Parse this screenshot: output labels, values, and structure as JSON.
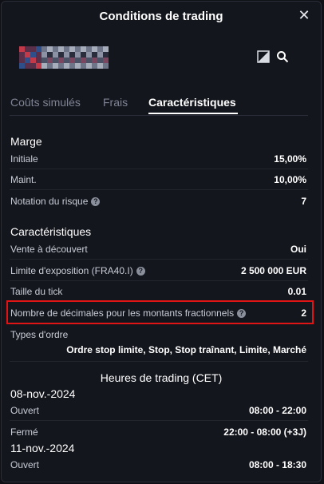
{
  "dialog": {
    "title": "Conditions de trading"
  },
  "tabs": [
    {
      "label": "Coûts simulés",
      "active": false
    },
    {
      "label": "Frais",
      "active": false
    },
    {
      "label": "Caractéristiques",
      "active": true
    }
  ],
  "margin": {
    "heading": "Marge",
    "initial_label": "Initiale",
    "initial_value": "15,00%",
    "maint_label": "Maint.",
    "maint_value": "10,00%",
    "risk_label": "Notation du risque",
    "risk_value": "7"
  },
  "features": {
    "heading": "Caractéristiques",
    "short_label": "Vente à découvert",
    "short_value": "Oui",
    "exposure_label": "Limite d'exposition (FRA40.I)",
    "exposure_value": "2 500 000 EUR",
    "tick_label": "Taille du tick",
    "tick_value": "0.01",
    "decimals_label": "Nombre de décimales pour les montants fractionnels",
    "decimals_value": "2",
    "order_types_label": "Types d'ordre",
    "order_types_value": "Ordre stop limite, Stop, Stop traînant, Limite, Marché"
  },
  "hours": {
    "heading": "Heures de trading (CET)",
    "days": [
      {
        "date": "08-nov.-2024",
        "open_label": "Ouvert",
        "open_value": "08:00 - 22:00",
        "closed_label": "Fermé",
        "closed_value": "22:00 - 08:00 (+3J)"
      },
      {
        "date": "11-nov.-2024",
        "open_label": "Ouvert",
        "open_value": "08:00 - 18:30"
      }
    ]
  },
  "icons": {
    "close": "close-icon",
    "chart": "chart-icon",
    "search": "search-icon",
    "help": "help-icon"
  },
  "colors": {
    "background": "#14161d",
    "highlight": "#e01414",
    "accent": "#ffffff"
  }
}
